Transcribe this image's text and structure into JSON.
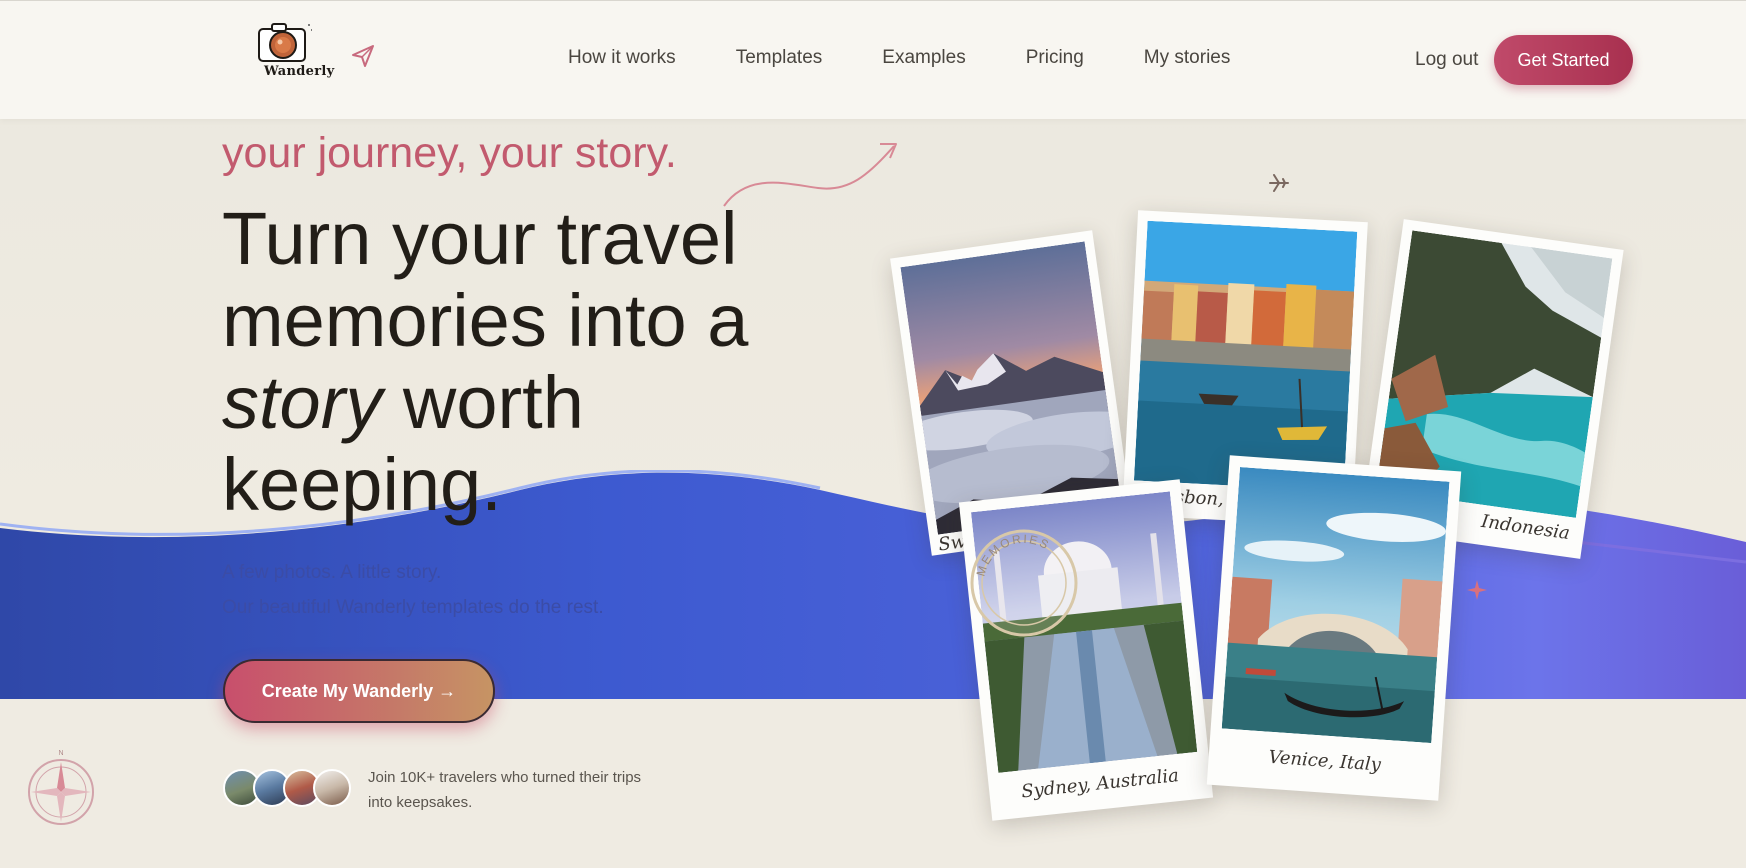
{
  "brand": {
    "name": "Wanderly"
  },
  "nav": {
    "items": [
      {
        "label": "How it works"
      },
      {
        "label": "Templates"
      },
      {
        "label": "Examples"
      },
      {
        "label": "Pricing"
      },
      {
        "label": "My stories"
      }
    ],
    "logout_label": "Log out",
    "cta_label": "Get Started"
  },
  "hero": {
    "tagline": "your journey, your story.",
    "headline_part1": "Turn your travel memories into a",
    "headline_italic": "story",
    "headline_part2": "worth keeping.",
    "subline1": "A few photos. A little story.",
    "subline2": "Our beautiful Wanderly templates do the rest.",
    "cta_label": "Create My Wanderly →",
    "social_proof": "Join 10K+ travelers who turned their trips into keepsakes."
  },
  "polaroids": [
    {
      "caption": "Sw"
    },
    {
      "caption": "Lisbon,"
    },
    {
      "caption": "Indonesia"
    },
    {
      "caption": "Sydney, Australia"
    },
    {
      "caption": "Venice, Italy"
    }
  ],
  "stamp": {
    "text": "MEMORIES"
  },
  "compass": {
    "north_label": "N"
  },
  "colors": {
    "accent": "#c04a6a",
    "wave_blue": "#4a5ed6",
    "wave_violet": "#6f6fe8",
    "tagline": "#c25a6e",
    "background": "#eeeae0"
  },
  "icons": [
    "camera-logo-icon",
    "paper-plane-icon",
    "airplane-icon",
    "sparkle-icon",
    "compass-icon",
    "arrow-icon"
  ]
}
